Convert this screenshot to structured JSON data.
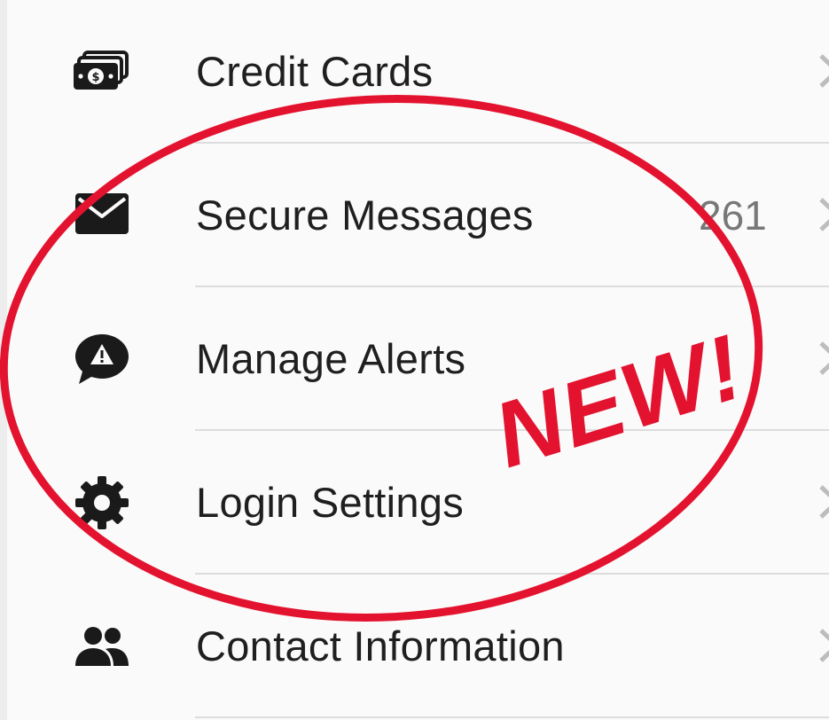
{
  "menu": {
    "items": [
      {
        "label": "Credit Cards",
        "icon": "credit-cards-icon",
        "count": ""
      },
      {
        "label": "Secure Messages",
        "icon": "envelope-icon",
        "count": "261"
      },
      {
        "label": "Manage Alerts",
        "icon": "alert-bubble-icon",
        "count": ""
      },
      {
        "label": "Login Settings",
        "icon": "gear-icon",
        "count": ""
      },
      {
        "label": "Contact Information",
        "icon": "people-icon",
        "count": ""
      }
    ]
  },
  "annotation": {
    "text": "NEW!",
    "color": "#e3132f"
  },
  "colors": {
    "background": "#fafafa",
    "text": "#1f1f1f",
    "count": "#777777",
    "divider": "#dcdcdc",
    "chevron": "#bdbdbd"
  }
}
